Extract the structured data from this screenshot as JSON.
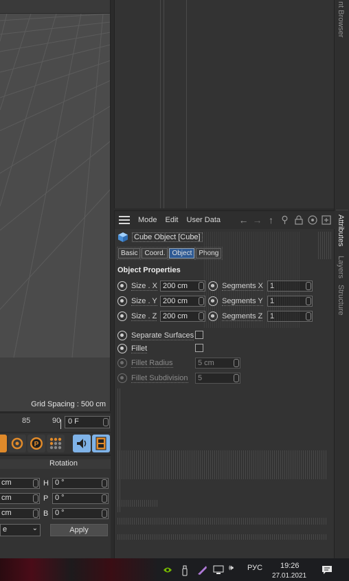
{
  "viewport": {
    "grid_spacing": "Grid Spacing : 500 cm"
  },
  "side_tabs": {
    "content_browser": "nt Browser",
    "attributes": "Attributes",
    "layers": "Layers",
    "structure": "Structure"
  },
  "attributes": {
    "menu": [
      "Mode",
      "Edit",
      "User Data"
    ],
    "object_title": "Cube Object [Cube]",
    "tabs": [
      "Basic",
      "Coord.",
      "Object",
      "Phong"
    ],
    "active_tab": "Object",
    "section_title": "Object Properties",
    "size_x_label": "Size . X",
    "size_y_label": "Size . Y",
    "size_z_label": "Size . Z",
    "size_x": "200 cm",
    "size_y": "200 cm",
    "size_z": "200 cm",
    "seg_x_label": "Segments X",
    "seg_y_label": "Segments Y",
    "seg_z_label": "Segments Z",
    "seg_x": "1",
    "seg_y": "1",
    "seg_z": "1",
    "separate_surfaces": "Separate Surfaces",
    "fillet": "Fillet",
    "fillet_radius_label": "Fillet Radius",
    "fillet_radius": "5 cm",
    "fillet_subdivision_label": "Fillet Subdivision",
    "fillet_subdivision": "5"
  },
  "timeline": {
    "tick_85": "85",
    "tick_90": "90",
    "current_frame": "0 F"
  },
  "coord": {
    "rotation_label": "Rotation",
    "pos_1": "cm",
    "pos_2": "cm",
    "pos_3": "cm",
    "h_label": "H",
    "p_label": "P",
    "b_label": "B",
    "h_value": "0 °",
    "p_value": "0 °",
    "b_value": "0 °",
    "mode_value": "e",
    "apply": "Apply"
  },
  "taskbar": {
    "lang": "РУС",
    "time": "19:26",
    "date": "27.01.2021"
  },
  "colors": {
    "accent_blue": "#2e5a94",
    "orange": "#e08a2a",
    "tool_blue": "#7fb3e8"
  }
}
